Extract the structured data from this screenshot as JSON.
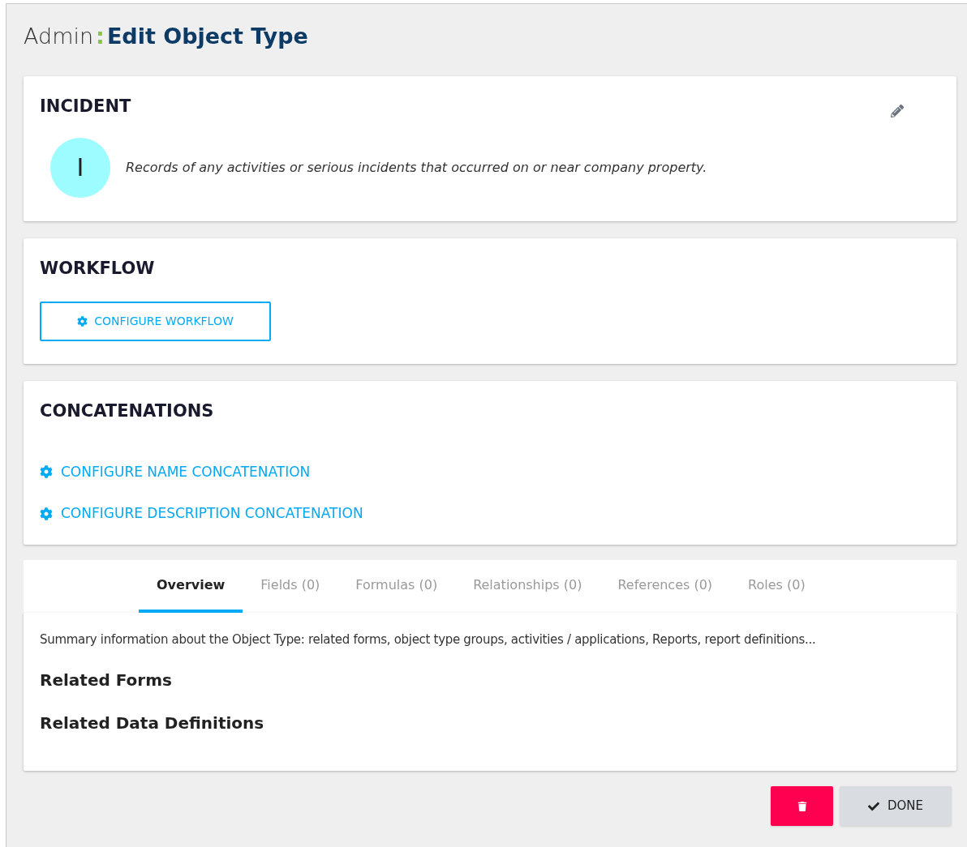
{
  "header": {
    "section": "Admin",
    "separator": ":",
    "title": "Edit Object Type"
  },
  "object_card": {
    "name": "INCIDENT",
    "avatar_letter": "I",
    "description": "Records of any activities or serious incidents that occurred on or near company property."
  },
  "workflow_card": {
    "title": "WORKFLOW",
    "button": "CONFIGURE WORKFLOW"
  },
  "concatenations_card": {
    "title": "CONCATENATIONS",
    "links": [
      "CONFIGURE NAME CONCATENATION",
      "CONFIGURE DESCRIPTION CONCATENATION"
    ]
  },
  "tabs": [
    {
      "label": "Overview",
      "selected": true
    },
    {
      "label": "Fields (0)",
      "selected": false
    },
    {
      "label": "Formulas (0)",
      "selected": false
    },
    {
      "label": "Relationships (0)",
      "selected": false
    },
    {
      "label": "References (0)",
      "selected": false
    },
    {
      "label": "Roles (0)",
      "selected": false
    }
  ],
  "overview": {
    "summary": "Summary information about the Object Type: related forms, object type groups, activities / applications, Reports, report definitions...",
    "headings": [
      "Related Forms",
      "Related Data Definitions"
    ]
  },
  "footer": {
    "done_button": "DONE"
  }
}
